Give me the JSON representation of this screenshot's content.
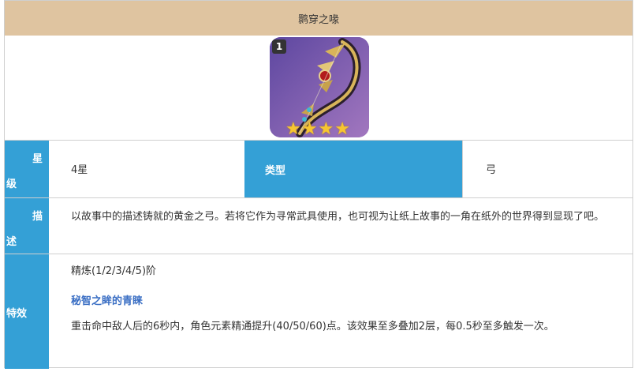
{
  "header": {
    "title": "鹮穿之喙"
  },
  "weapon_icon": {
    "refine_badge": "1",
    "stars_shown": 4,
    "background": "#7a5aa8"
  },
  "rarity": {
    "label_top": "星",
    "label_bottom": "级",
    "value": "4星"
  },
  "type": {
    "label": "类型",
    "value": "弓"
  },
  "description": {
    "label_top": "描",
    "label_bottom": "述",
    "text": "以故事中的描述铸就的黄金之弓。若将它作为寻常武具使用，也可视为让纸上故事的一角在纸外的世界得到显现了吧。"
  },
  "effect": {
    "label": "特效",
    "refine": "精炼(1/2/3/4/5)阶",
    "skill_name": "秘智之眸的青睐",
    "text": "重击命中敌人后的6秒内，角色元素精通提升(40/50/60)点。该效果至多叠加2层，每0.5秒至多触发一次。"
  },
  "colors": {
    "header_bg": "#dfc4a0",
    "label_bg": "#34a0d6",
    "skill_color": "#3b6fc4"
  }
}
